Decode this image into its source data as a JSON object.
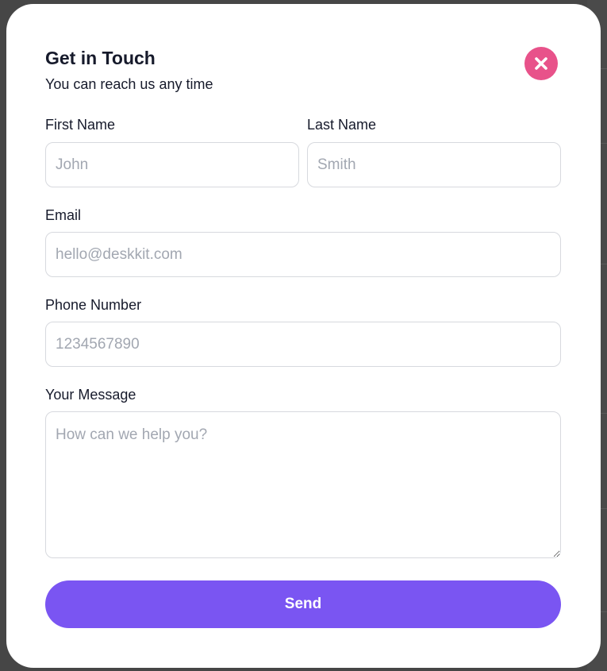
{
  "modal": {
    "title": "Get in Touch",
    "subtitle": "You can reach us any time",
    "close_icon": "close-icon"
  },
  "form": {
    "first_name": {
      "label": "First Name",
      "placeholder": "John"
    },
    "last_name": {
      "label": "Last Name",
      "placeholder": "Smith"
    },
    "email": {
      "label": "Email",
      "placeholder": "hello@deskkit.com"
    },
    "phone": {
      "label": "Phone Number",
      "placeholder": "1234567890"
    },
    "message": {
      "label": "Your Message",
      "placeholder": "How can we help you?"
    },
    "submit_label": "Send"
  },
  "colors": {
    "accent": "#7a55f2",
    "close": "#e8528a",
    "text": "#161a2b",
    "placeholder": "#a2a7b1",
    "border": "#d7d9de"
  }
}
